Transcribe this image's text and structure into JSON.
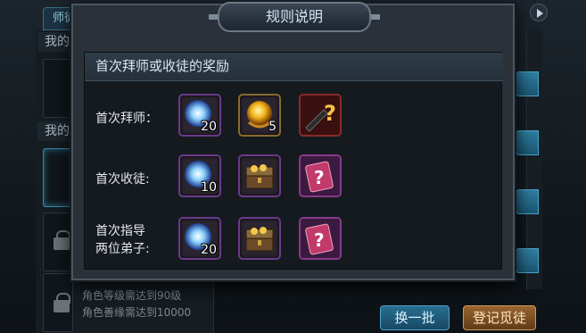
{
  "background": {
    "tab_label": "师徒",
    "section_mine_1": "我的",
    "section_mine_2": "我的",
    "requirements": [
      "角色等级需达到90级",
      "角色善缘需达到10000"
    ],
    "swap_button": "换一批",
    "register_button": "登记觅徒"
  },
  "modal": {
    "title": "规则说明",
    "section_header": "首次拜师或收徒的奖励",
    "rows": [
      {
        "label": "首次拜师：",
        "rewards": [
          {
            "icon": "blue-orb-icon",
            "qty": "20"
          },
          {
            "icon": "golden-orb-icon",
            "qty": "5"
          },
          {
            "icon": "mystery-weapon-icon",
            "qty": ""
          }
        ]
      },
      {
        "label": "首次收徒:",
        "rewards": [
          {
            "icon": "blue-orb-icon",
            "qty": "10"
          },
          {
            "icon": "treasure-chest-icon",
            "qty": ""
          },
          {
            "icon": "mystery-scroll-icon",
            "qty": ""
          }
        ]
      },
      {
        "label_line1": "首次指导",
        "label_line2": "两位弟子:",
        "rewards": [
          {
            "icon": "blue-orb-icon",
            "qty": "20"
          },
          {
            "icon": "treasure-chest-icon",
            "qty": ""
          },
          {
            "icon": "mystery-scroll-icon",
            "qty": ""
          }
        ]
      }
    ]
  },
  "colors": {
    "accent_blue": "#2a6f92",
    "accent_gold": "#9a6630",
    "item_border_purple": "#6a3a8c"
  }
}
